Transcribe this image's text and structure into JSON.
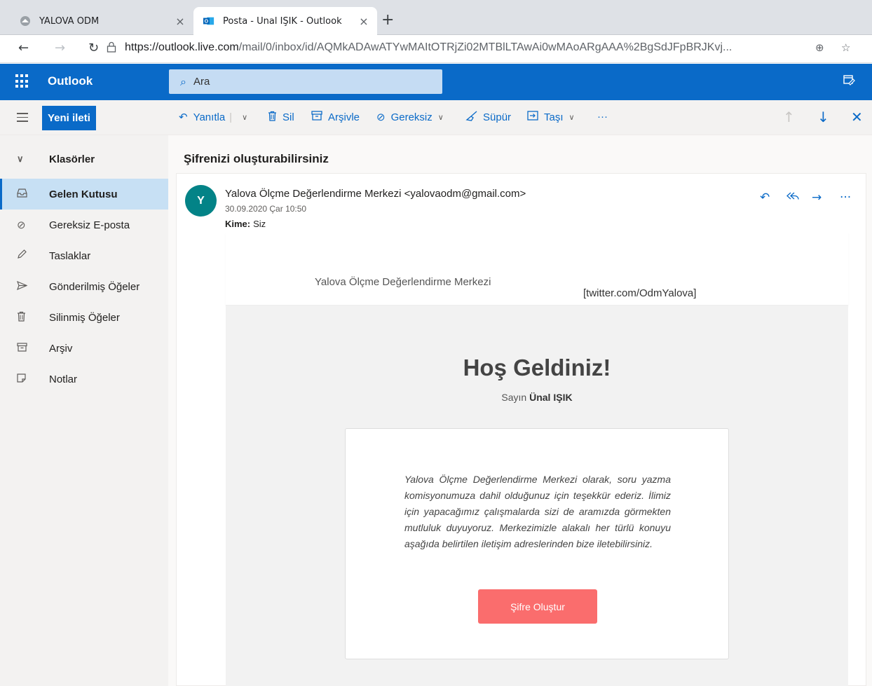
{
  "browser": {
    "tabs": [
      {
        "title": "YALOVA ÖDM",
        "close": "×"
      },
      {
        "title": "Posta - Ünal IŞIK - Outlook",
        "close": "×"
      }
    ],
    "new_tab": "+",
    "url_host": "https://outlook.live.com",
    "url_path": "/mail/0/inbox/id/AQMkADAwATYwMAItOTRjZi02MTBlLTAwAi0wMAoARgAAA%2BgSdJFpBRJKvj..."
  },
  "outlook": {
    "brand": "Outlook",
    "search_placeholder": "Ara",
    "new_message": "Yeni ileti",
    "commands": {
      "reply": "Yanıtla",
      "delete": "Sil",
      "archive": "Arşivle",
      "junk": "Gereksiz",
      "sweep": "Süpür",
      "move": "Taşı",
      "more": "···"
    },
    "folders_header": "Klasörler",
    "folders": [
      {
        "label": "Gelen Kutusu",
        "icon": "inbox-icon",
        "selected": true
      },
      {
        "label": "Gereksiz E-posta",
        "icon": "junk-icon"
      },
      {
        "label": "Taslaklar",
        "icon": "pencil-icon"
      },
      {
        "label": "Gönderilmiş Öğeler",
        "icon": "send-icon"
      },
      {
        "label": "Silinmiş Öğeler",
        "icon": "trash-icon"
      },
      {
        "label": "Arşiv",
        "icon": "archive-icon"
      },
      {
        "label": "Notlar",
        "icon": "note-icon"
      }
    ]
  },
  "message": {
    "subject": "Şifrenizi oluşturabilirsiniz",
    "avatar_letter": "Y",
    "sender": "Yalova Ölçme Değerlendirme Merkezi <yalovaodm@gmail.com>",
    "date": "30.09.2020 Çar 10:50",
    "to_label": "Kime:",
    "to_value": "Siz",
    "more": "···"
  },
  "email": {
    "banner_title": "Yalova Ölçme Değerlendirme Merkezi",
    "banner_link": "[twitter.com/OdmYalova]",
    "welcome": "Hoş Geldiniz!",
    "dear_prefix": "Sayın",
    "dear_name": "Ünal IŞIK",
    "paragraph": "Yalova Ölçme Değerlendirme Merkezi olarak, soru yazma komisyonumuza dahil olduğunuz için teşekkür ederiz. İlimiz için yapacağımız çalışmalarda sizi de aramızda görmekten mutluluk duyuyoruz. Merkezimizle alakalı her türlü konuyu aşağıda belirtilen iletişim adreslerinden bize iletebilirsiniz.",
    "cta": "Şifre Oluştur"
  },
  "colors": {
    "outlook_blue": "#0a6ac8",
    "selected_folder": "#c7e0f4",
    "avatar": "#038387",
    "cta": "#fa6d6d"
  }
}
